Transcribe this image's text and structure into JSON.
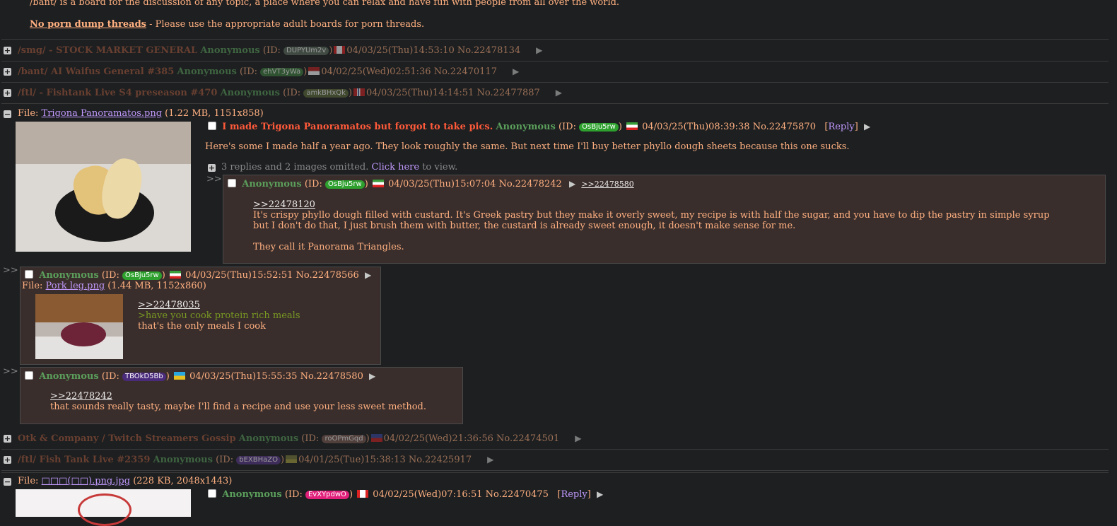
{
  "rules": {
    "desc": "/bant/ is a board for the discussion of any topic, a place where you can relax and have fun with people from all over the world.",
    "bold": "No porn dump threads",
    "rest": " - Please use the appropriate adult boards for porn threads."
  },
  "hidden_threads": [
    {
      "subject": "/smg/ - STOCK MARKET GENERAL",
      "name": "Anonymous",
      "id": "DUPYUm2v",
      "id_color": "#5e6e5e",
      "date": "04/03/25(Thu)14:53:10",
      "no": "No.22478134"
    },
    {
      "subject": "/bant/ AI Waifus General #385",
      "name": "Anonymous",
      "id": "ehVT3yWa",
      "id_color": "#3e7e3e",
      "date": "04/02/25(Wed)02:51:36",
      "no": "No.22470117"
    },
    {
      "subject": "/ftl/ - Fishtank Live S4 preseason #470",
      "name": "Anonymous",
      "id": "amkBHxQk",
      "id_color": "#5d6a3a",
      "date": "04/03/25(Thu)14:14:51",
      "no": "No.22477887"
    },
    {
      "subject": "Otk & Company / Twitch Streamers Gossip",
      "name": "Anonymous",
      "id": "roOPmGqd",
      "id_color": "#7a5a52",
      "date": "04/02/25(Wed)21:36:56",
      "no": "No.22474501"
    },
    {
      "subject": "/ftl/ Fish Tank Live #2359",
      "name": "Anonymous",
      "id": "bEXBHaZO",
      "id_color": "#5a3a8a",
      "date": "04/01/25(Tue)15:38:13",
      "no": "No.22425917"
    }
  ],
  "op": {
    "file_label": "File: ",
    "file_name": "Trigona Panoramatos.png",
    "file_info": " (1.22 MB, 1151x858)",
    "subject": "I made Trigona Panoramatos but forgot to take pics.",
    "name": "Anonymous",
    "id": "OsBju5rw",
    "id_color": "#2ea02e",
    "date": "04/03/25(Thu)08:39:38",
    "no": "No.22475870",
    "reply_label": "Reply",
    "body": "Here's some I made half a year ago. They look roughly the same. But next time I'll buy better phyllo dough sheets because this one sucks.",
    "omitted": "3 replies and 2 images omitted.",
    "click_here": "Click here",
    "to_view": " to view."
  },
  "replies": [
    {
      "name": "Anonymous",
      "id": "OsBju5rw",
      "id_color": "#2ea02e",
      "date": "04/03/25(Thu)15:07:04",
      "no": "No.22478242",
      "backlink": ">>22478580",
      "quote": ">>22478120",
      "line1": "It's crispy phyllo dough filled with custard. It's Greek pastry but they make it overly sweet, my recipe is with half the sugar, and you have to dip the pastry in simple syrup",
      "line2": "but I don't do that, I just brush them with butter, the custard is already sweet enough, it doesn't make sense for me.",
      "line3": "They call it Panorama Triangles."
    },
    {
      "name": "Anonymous",
      "id": "OsBju5rw",
      "id_color": "#2ea02e",
      "date": "04/03/25(Thu)15:52:51",
      "no": "No.22478566",
      "file_label": "File: ",
      "file_name": "Pork leg.png",
      "file_info": " (1.44 MB, 1152x860)",
      "quote": ">>22478035",
      "greentext": ">have you cook protein rich meals",
      "line1": "that's the only meals I cook"
    },
    {
      "name": "Anonymous",
      "id": "TBOkD5Bb",
      "id_color": "#4a2a7a",
      "date": "04/03/25(Thu)15:55:35",
      "no": "No.22478580",
      "quote": ">>22478242",
      "line1": "that sounds really tasty, maybe I'll find a recipe and use your less sweet method."
    }
  ],
  "op2": {
    "file_label": "File: ",
    "file_name": "□□□(□□).png.jpg",
    "file_info": " (228 KB, 2048x1443)",
    "name": "Anonymous",
    "id": "EvXYpdwO",
    "id_color": "#e0207a",
    "date": "04/02/25(Wed)07:16:51",
    "no": "No.22470475",
    "reply_label": "Reply"
  },
  "icons": {
    "expand": "+",
    "collapse": "−",
    "arrow": "▶",
    "quote_arrow": ">>"
  }
}
